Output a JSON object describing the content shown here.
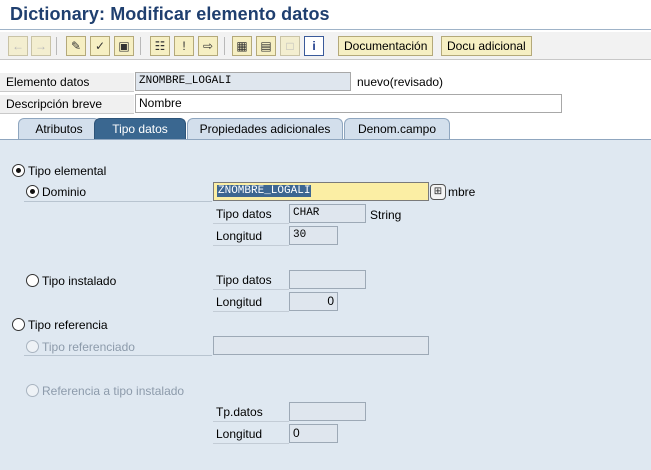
{
  "window": {
    "title": "Dictionary: Modificar elemento datos"
  },
  "toolbar": {
    "documentation_label": "Documentación",
    "extra_doc_label": "Docu adicional",
    "icons": [
      "back-arrow-icon",
      "forward-arrow-icon",
      "display-change-icon",
      "check-icon",
      "activate-icon",
      "where-used-icon",
      "information-icon",
      "navigate-icon",
      "hierarchy-icon",
      "print-icon",
      "frame-icon",
      "info-icon"
    ]
  },
  "header": {
    "element_label": "Elemento datos",
    "element_value": "ZNOMBRE_LOGALI",
    "element_status": "nuevo(revisado)",
    "description_label": "Descripción breve",
    "description_value": "Nombre"
  },
  "tabs": [
    {
      "label": "Atributos",
      "active": false
    },
    {
      "label": "Tipo datos",
      "active": true
    },
    {
      "label": "Propiedades adicionales",
      "active": false
    },
    {
      "label": "Denom.campo",
      "active": false
    }
  ],
  "panel": {
    "tipo_elemental": {
      "label": "Tipo elemental",
      "checked": true
    },
    "dominio": {
      "label": "Dominio",
      "checked": true,
      "value": "ZNOMBRE_LOGALI",
      "trailing_text": "mbre",
      "tipo_datos_label": "Tipo datos",
      "tipo_datos_value": "CHAR",
      "tipo_datos_desc": "String",
      "longitud_label": "Longitud",
      "longitud_value": "30"
    },
    "tipo_instalado": {
      "label": "Tipo instalado",
      "checked": false,
      "tipo_datos_label": "Tipo datos",
      "tipo_datos_value": "",
      "longitud_label": "Longitud",
      "longitud_value": "0"
    },
    "tipo_referencia": {
      "label": "Tipo referencia",
      "checked": false
    },
    "tipo_referenciado": {
      "label": "Tipo referenciado",
      "value": ""
    },
    "referencia_tipo_instalado": {
      "label": "Referencia a tipo instalado",
      "tp_datos_label": "Tp.datos",
      "tp_datos_value": "",
      "longitud_label": "Longitud",
      "longitud_value": "0"
    }
  },
  "colors": {
    "title": "#1f3f6f",
    "active_tab": "#3a6790",
    "panel_bg": "#dfe8f1",
    "focus_field": "#fbeea4",
    "button_bg": "#f6efc3"
  }
}
